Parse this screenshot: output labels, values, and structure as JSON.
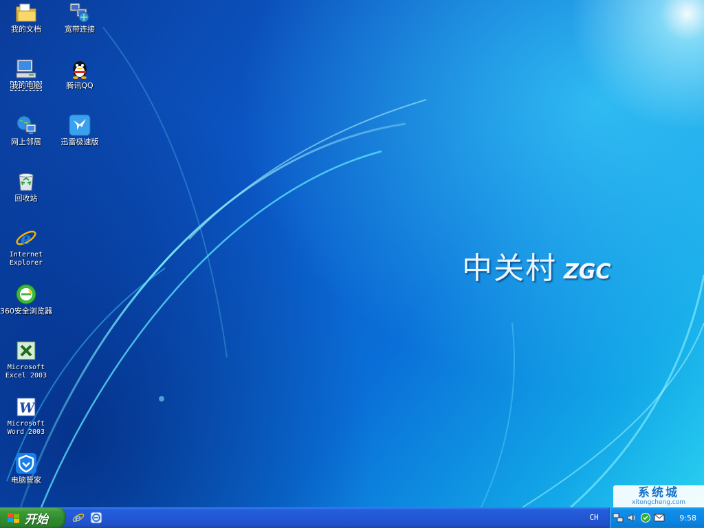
{
  "desktop_icons": [
    {
      "label": "我的文档",
      "icon": "my-documents-icon"
    },
    {
      "label": "宽带连接",
      "icon": "broadband-connection-icon"
    },
    {
      "label": "我的电脑",
      "icon": "my-computer-icon",
      "selected": true
    },
    {
      "label": "腾讯QQ",
      "icon": "qq-penguin-icon"
    },
    {
      "label": "网上邻居",
      "icon": "network-places-icon"
    },
    {
      "label": "迅雷极速版",
      "icon": "thunder-icon"
    },
    {
      "label": "回收站",
      "icon": "recycle-bin-icon"
    },
    {
      "label": "Internet\nExplorer",
      "icon": "internet-explorer-icon"
    },
    {
      "label": "360安全浏览器",
      "icon": "360-browser-icon"
    },
    {
      "label": "Microsoft\nExcel 2003",
      "icon": "excel-icon"
    },
    {
      "label": "Microsoft\nWord 2003",
      "icon": "word-icon"
    },
    {
      "label": "电脑管家",
      "icon": "pc-manager-shield-icon"
    }
  ],
  "wallpaper": {
    "brand_cn": "中关村",
    "brand_en": "ZGC"
  },
  "watermark": {
    "main": "系统城",
    "sub": "xitongcheng.com"
  },
  "taskbar": {
    "start_label": "开始",
    "quick_launch": [
      "internet-explorer-icon",
      "360-browser-icon"
    ],
    "language": "CH",
    "tray_icons": [
      "network-icon",
      "volume-icon",
      "security-icon",
      "mail-icon"
    ],
    "clock": "9:58"
  },
  "colors": {
    "taskbar_blue": "#245edb",
    "start_green": "#3c9b39",
    "tray_blue": "#0c87e3"
  }
}
